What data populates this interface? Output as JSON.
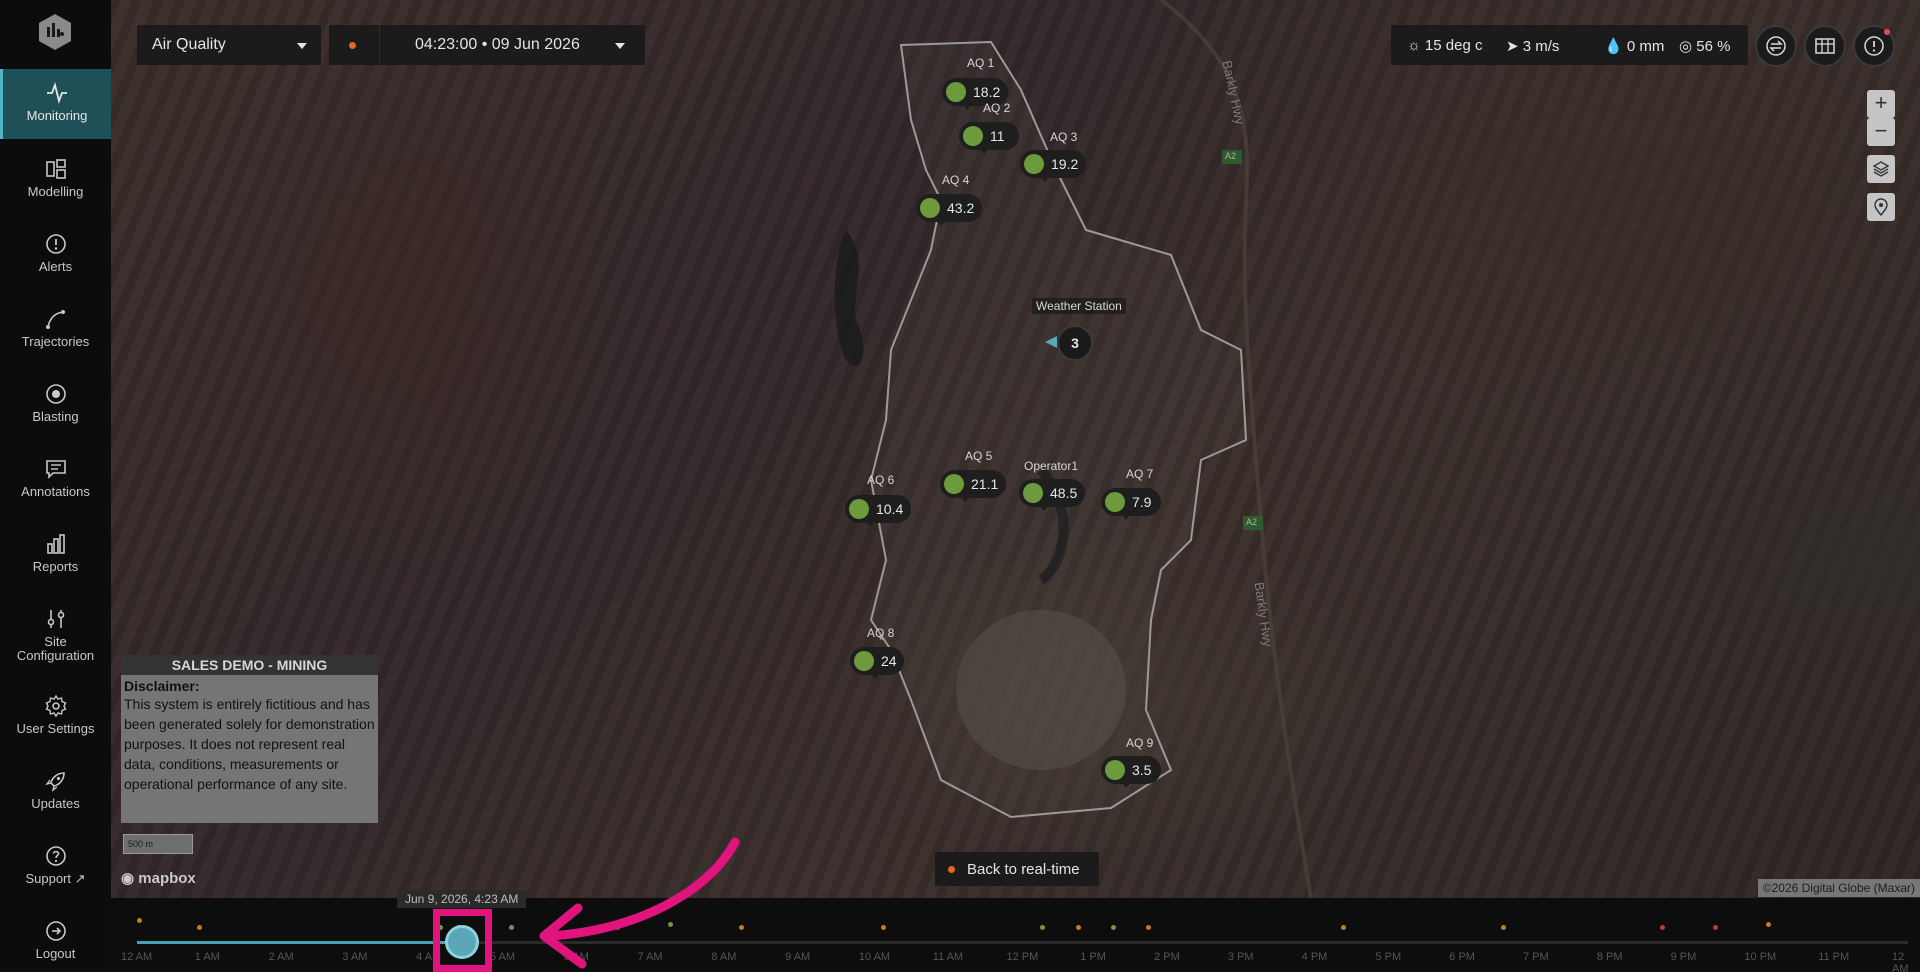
{
  "sidebar": {
    "items": [
      {
        "label": "Monitoring",
        "icon": "pulse-icon",
        "active": true
      },
      {
        "label": "Modelling",
        "icon": "layout-icon"
      },
      {
        "label": "Alerts",
        "icon": "alert-circle-icon"
      },
      {
        "label": "Trajectories",
        "icon": "trajectory-icon"
      },
      {
        "label": "Blasting",
        "icon": "target-icon"
      },
      {
        "label": "Annotations",
        "icon": "comment-icon"
      },
      {
        "label": "Reports",
        "icon": "bar-chart-icon"
      },
      {
        "label": "Site",
        "label2": "Configuration",
        "icon": "sliders-icon"
      },
      {
        "label": "User Settings",
        "icon": "gear-icon"
      },
      {
        "label": "Updates",
        "icon": "rocket-icon"
      },
      {
        "label": "Support",
        "icon": "help-icon"
      },
      {
        "label": "Logout",
        "icon": "logout-icon"
      }
    ]
  },
  "header": {
    "layer_select": "Air Quality",
    "time": "04:23:00",
    "date": "09 Jun 2026",
    "time_display": "04:23:00  •  09 Jun 2026"
  },
  "weather": {
    "temperature": "15 deg c",
    "wind": "3 m/s",
    "rain": "0 mm",
    "humidity": "56 %"
  },
  "sensors": [
    {
      "name": "AQ 1",
      "value": "18.2"
    },
    {
      "name": "AQ 2",
      "value": "11"
    },
    {
      "name": "AQ 3",
      "value": "19.2"
    },
    {
      "name": "AQ 4",
      "value": "43.2"
    },
    {
      "name": "AQ 5",
      "value": "21.1"
    },
    {
      "name": "Operator1",
      "value": "48.5"
    },
    {
      "name": "AQ 6",
      "value": "10.4"
    },
    {
      "name": "AQ 7",
      "value": "7.9"
    },
    {
      "name": "AQ 8",
      "value": "24"
    },
    {
      "name": "AQ 9",
      "value": "3.5"
    }
  ],
  "weather_station": {
    "label": "Weather Station",
    "count": "3"
  },
  "roads": {
    "a": "Barkly Hwy",
    "b": "Barkly Hwy",
    "badge": "A2"
  },
  "disclaimer": {
    "title": "SALES DEMO - MINING",
    "heading": "Disclaimer:",
    "body": "This system is entirely fictitious and has been generated solely for demonstration purposes. It does not represent real data, conditions, measurements or operational performance of any site."
  },
  "scale_label": "500 m",
  "mapbox_label": "mapbox",
  "back_realtime": "Back to real-time",
  "copyright": "©2026 Digital Globe (Maxar)",
  "timeline": {
    "tooltip": "Jun 9, 2026, 4:23 AM",
    "progress": 0.18,
    "ticks": [
      "12 AM",
      "1 AM",
      "2 AM",
      "3 AM",
      "4 AM",
      "5 AM",
      "6 AM",
      "7 AM",
      "8 AM",
      "9 AM",
      "10 AM",
      "11 AM",
      "12 PM",
      "1 PM",
      "2 PM",
      "3 PM",
      "4 PM",
      "5 PM",
      "6 PM",
      "7 PM",
      "8 PM",
      "9 PM",
      "10 PM",
      "11 PM",
      "12 AM"
    ]
  },
  "colors": {
    "accent": "#4a9fb0",
    "sensor_ok": "#6c9a3c",
    "highlight": "#e0147c",
    "event_orange": "#c87a1e",
    "event_green": "#6c9a3c",
    "event_red": "#c2392e"
  }
}
